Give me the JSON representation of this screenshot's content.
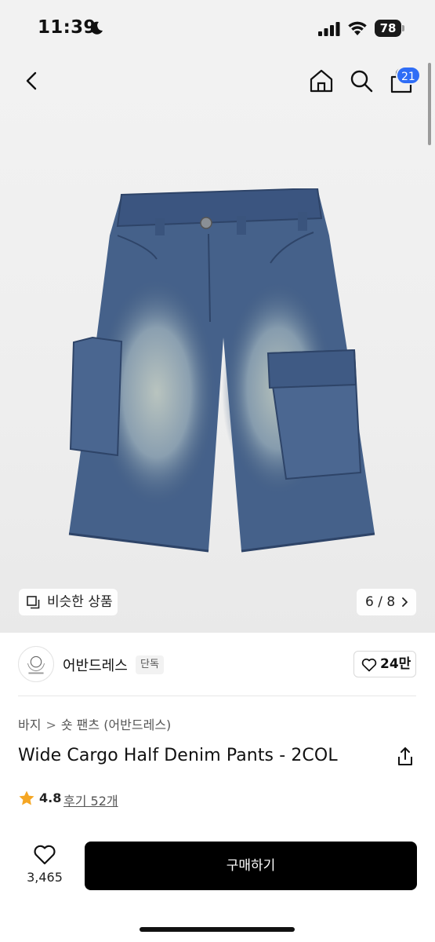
{
  "status_bar": {
    "time": "11:39",
    "battery": "78"
  },
  "nav": {
    "cart_badge": "21",
    "icons": [
      "back-icon",
      "home-icon",
      "search-icon",
      "cart-icon"
    ]
  },
  "gallery": {
    "similar_label": "비슷한 상품",
    "counter": "6 / 8"
  },
  "seller": {
    "name": "어반드레스",
    "tag": "단독",
    "likes": "24만"
  },
  "product": {
    "breadcrumb": [
      "바지",
      "숏 팬츠 (어반드레스)"
    ],
    "title": "Wide Cargo Half Denim Pants - 2COL",
    "rating": "4.8",
    "reviews": "후기 52개"
  },
  "bottom_bar": {
    "wish_count": "3,465",
    "buy_label": "구매하기"
  },
  "colors": {
    "accent_badge": "#2f6df6",
    "buy_button": "#000000",
    "star": "#f5a623"
  }
}
